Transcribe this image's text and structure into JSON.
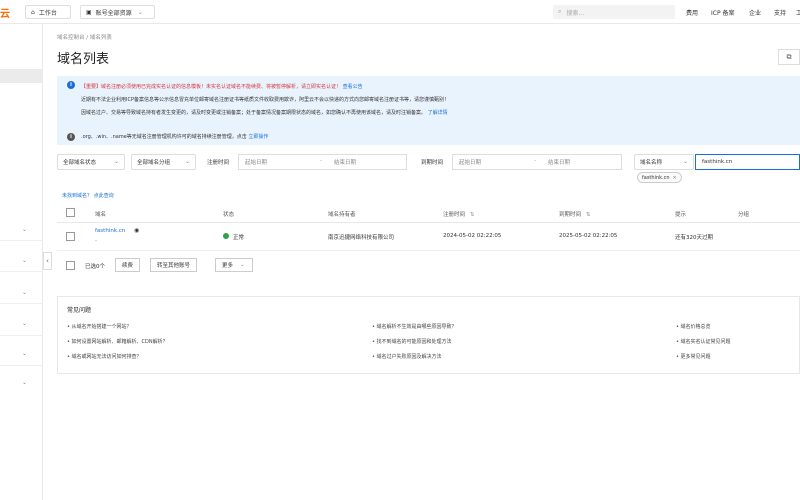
{
  "topbar": {
    "logo_fragment": "云",
    "workbench": "工作台",
    "account": "账号全部资源",
    "search_placeholder": "搜索...",
    "links": [
      "费用",
      "ICP 备案",
      "企业",
      "支持",
      "工"
    ]
  },
  "breadcrumb": "域名控制台  /  域名列表",
  "page_title": "域名列表",
  "notice": {
    "line1_prefix": "【重要】域名注册必须使用已完成实名认证的信息模板！未实名认证域名不能续费、将被暂停解析，请立即实名认证！",
    "line1_link": "查看公告",
    "line2": "近期有不法企业利用ICP备案信息等公示信息冒充单位邮寄域名注册证书等纸质文件收取费用欺诈，阿里云不会以快递的方式向您邮寄域名注册证书等，请您谨慎甄别！",
    "line3_prefix": "因域名过户、交易等导致域名持有者发生变更的，请及时变更或注销备案；处于备案情况备案期限状态的域名，如您确认不再使用该域名，请及时注销备案。",
    "line3_link": "了解详情",
    "line4_prefix": ".org、.win、.name等无域名注册管理机构许可的域名持续注册管理，点击",
    "line4_link": "立即操作"
  },
  "filters": {
    "status": "全部域名状态",
    "group": "全部域名分组",
    "reg_label": "注册时间",
    "reg_start": "起始日期",
    "reg_end": "结束日期",
    "exp_label": "到期时间",
    "exp_start": "起始日期",
    "exp_end": "结束日期",
    "search_field": "域名名称",
    "search_value": "fasthink.cn",
    "tag_value": "fasthink.cn"
  },
  "not_found_text": "未找到域名？",
  "not_found_link": "点此查询",
  "table": {
    "headers": [
      "域名",
      "状态",
      "域名持有者",
      "注册时间",
      "到期时间",
      "提示",
      "分组"
    ],
    "rows": [
      {
        "domain": "fasthink.cn",
        "sub": "-",
        "status": "正常",
        "owner": "南京迅捷网络科技有限公司",
        "registered": "2024-05-02 02:22:05",
        "expires": "2025-05-02 02:22:05",
        "hint": "还有320天过期",
        "group": ""
      }
    ]
  },
  "batch": {
    "selected": "已选0个",
    "renew": "续费",
    "transfer": "转至其他账号",
    "more": "更多"
  },
  "faq": {
    "title": "常见问题",
    "items": [
      "从域名开始搭建一个网站？",
      "域名解析不生效是由哪些原因导致？",
      "域名价格总览",
      "如何设置网站解析、邮箱解析、CDN解析？",
      "找不到域名的可能原因和处理方法",
      "域名实名认证常见问题",
      "域名或网站无法访问如何排查？",
      "域名过户失败原因及解决方法",
      "更多常见问题"
    ]
  },
  "colors": {
    "accent": "#1a6ed8",
    "notice_bg": "#e9f3fd",
    "warning_red": "#d9363e",
    "status_green": "#2ba24c",
    "brand_orange": "#ff6a00"
  }
}
